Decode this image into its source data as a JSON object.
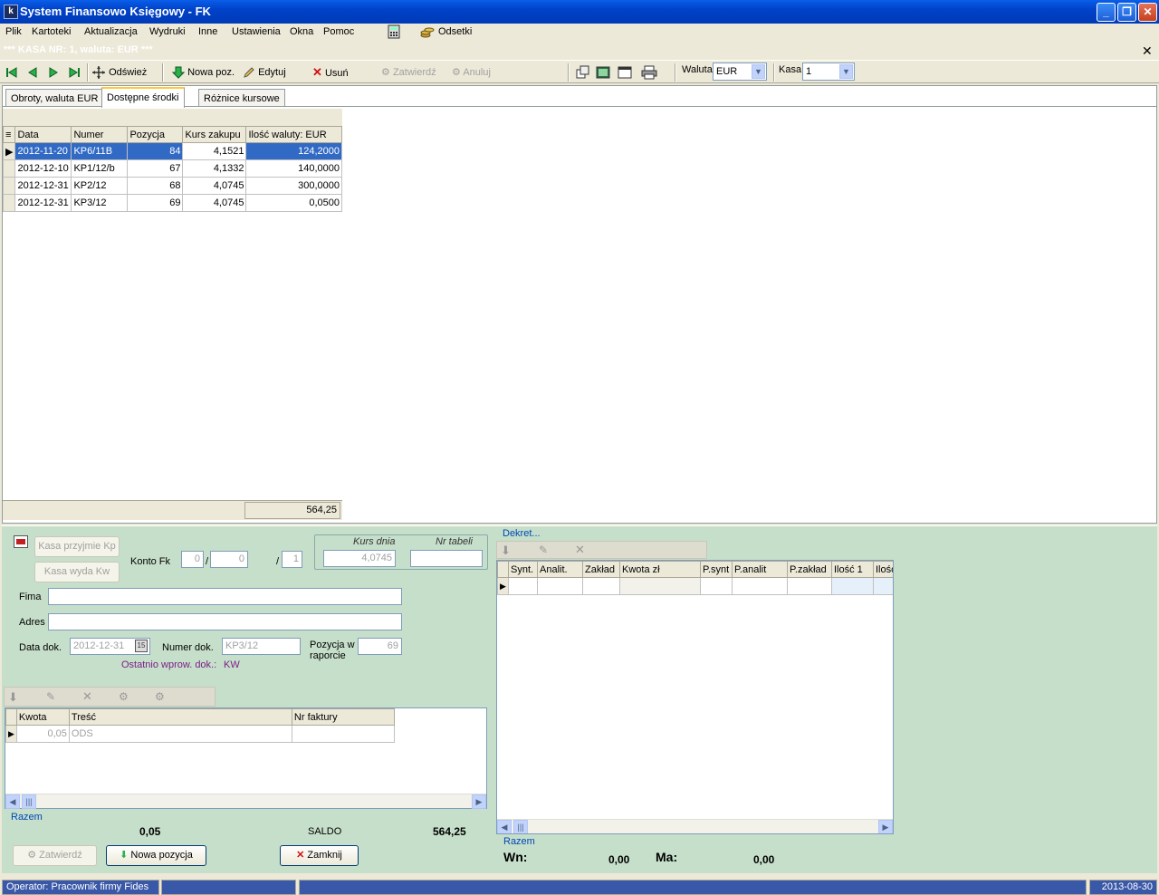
{
  "window": {
    "title": "System Finansowo Księgowy - FK"
  },
  "menu": [
    "Plik",
    "Kartoteki",
    "Aktualizacja",
    "Wydruki",
    "Inne",
    "Ustawienia",
    "Okna",
    "Pomoc"
  ],
  "menu_extra": {
    "odsetki": "Odsetki"
  },
  "subtitle": "*** KASA NR: 1, waluta: EUR ***",
  "toolbar": {
    "refresh": "Odśwież",
    "new": "Nowa poz.",
    "edit": "Edytuj",
    "delete": "Usuń",
    "confirm": "Zatwierdź",
    "cancel": "Anuluj",
    "currency_label": "Waluta",
    "currency_value": "EUR",
    "cash_label": "Kasa",
    "cash_value": "1"
  },
  "tabs": [
    "Obroty, waluta EUR",
    "Dostępne środki",
    "Różnice kursowe"
  ],
  "grid": {
    "headers": [
      "Data",
      "Numer",
      "Pozycja",
      "Kurs zakupu",
      "Ilość waluty: EUR"
    ],
    "rows": [
      [
        "2012-11-20",
        "KP6/11B",
        "84",
        "4,1521",
        "124,2000"
      ],
      [
        "2012-12-10",
        "KP1/12/b",
        "67",
        "4,1332",
        "140,0000"
      ],
      [
        "2012-12-31",
        "KP2/12",
        "68",
        "4,0745",
        "300,0000"
      ],
      [
        "2012-12-31",
        "KP3/12",
        "69",
        "4,0745",
        "0,0500"
      ]
    ],
    "total": "564,25"
  },
  "form": {
    "kasa_przyjmie": "Kasa przyjmie  Kp",
    "kasa_wyda": "Kasa wyda  Kw",
    "konto_fk_label": "Konto Fk",
    "konto_1": "0",
    "konto_2": "0",
    "konto_3": "1",
    "kurs_dnia_label": "Kurs dnia",
    "kurs_dnia_value": "4,0745",
    "nr_tabeli_label": "Nr tabeli",
    "nr_tabeli_value": "",
    "firma_label": "Fima",
    "adres_label": "Adres",
    "data_dok_label": "Data dok.",
    "data_dok_value": "2012-12-31",
    "numer_dok_label": "Numer dok.",
    "numer_dok_value": "KP3/12",
    "pozycja_label_1": "Pozycja w",
    "pozycja_label_2": "raporcie",
    "pozycja_value": "69",
    "ostatnio_label": "Ostatnio wprow. dok.:",
    "ostatnio_value": "KW"
  },
  "items": {
    "headers": [
      "Kwota",
      "Treść",
      "Nr faktury"
    ],
    "rows": [
      [
        "0,05",
        "ODS",
        ""
      ]
    ],
    "razem_label": "Razem",
    "razem_value": "0,05",
    "saldo_label": "SALDO",
    "saldo_value": "564,25"
  },
  "bottom_buttons": {
    "zatwierdz": "Zatwierdź",
    "nowa_pozycja": "Nowa pozycja",
    "zamknij": "Zamknij"
  },
  "dekret": {
    "label": "Dekret...",
    "headers": [
      "Synt.",
      "Analit.",
      "Zakład",
      "Kwota zł",
      "P.synt",
      "P.analit",
      "P.zakład",
      "Ilość 1",
      "Ilość"
    ],
    "razem_label": "Razem",
    "wn_label": "Wn:",
    "wn_value": "0,00",
    "ma_label": "Ma:",
    "ma_value": "0,00"
  },
  "status": {
    "operator": "Operator: Pracownik firmy Fides",
    "date": "2013-08-30"
  },
  "colors": {
    "title_blue": "#0a5ee8",
    "selection": "#316ac5",
    "lower_panel": "#c6dfca",
    "dekret_label": "#0046b8",
    "ostatnio": "#7a1f86"
  }
}
